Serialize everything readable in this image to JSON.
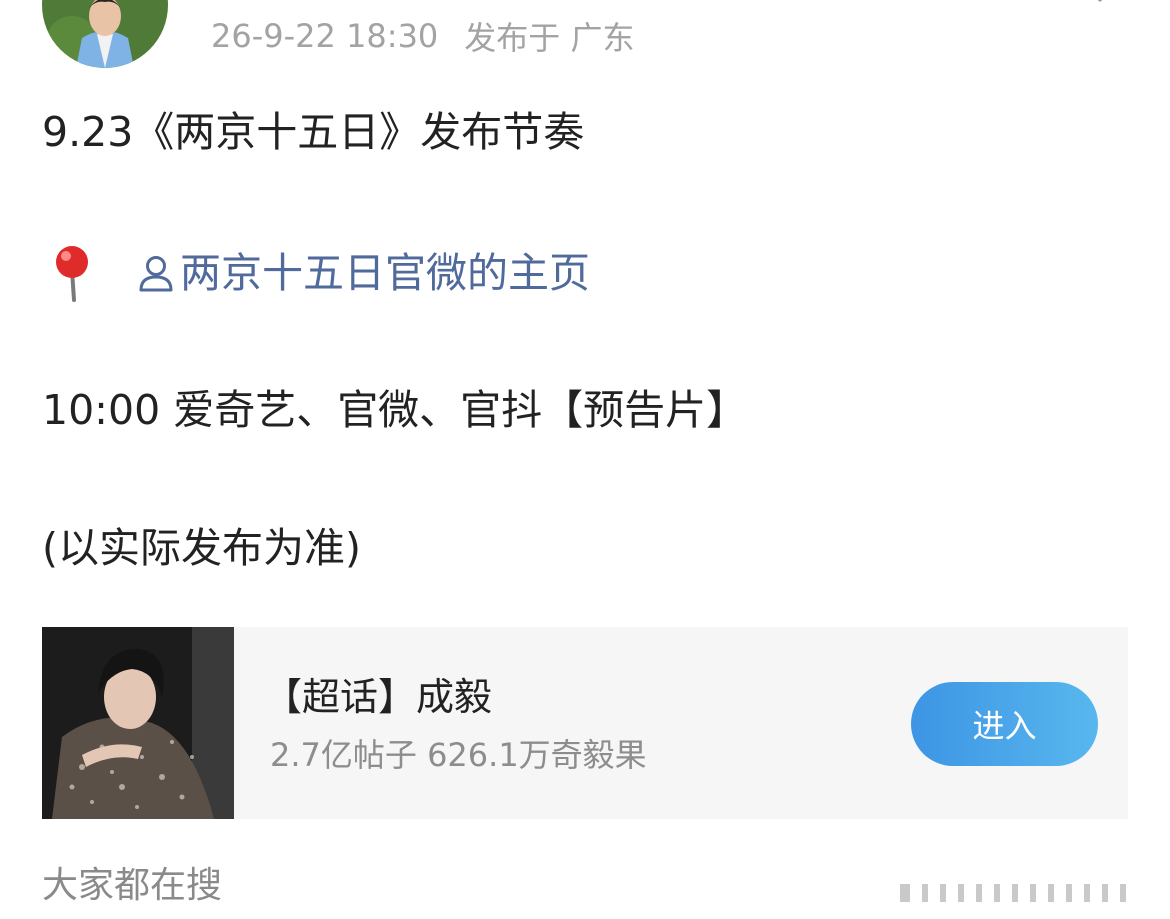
{
  "post": {
    "meta": {
      "time": "26-9-22 18:30",
      "location": "发布于 广东"
    },
    "line1": "9.23《两京十五日》发布节奏",
    "mention": "两京十五日官微的主页",
    "line3": "10:00 爱奇艺、官微、官抖【预告片】",
    "line4": "(以实际发布为准)"
  },
  "icons": {
    "avatar": "avatar",
    "star": "star-outline-icon",
    "pin": "round-pushpin-icon",
    "person": "person-icon"
  },
  "topic_card": {
    "title": "【超话】成毅",
    "stats": "2.7亿帖子 626.1万奇毅果",
    "button_label": "进入"
  },
  "section": {
    "search_heading": "大家都在搜"
  },
  "colors": {
    "mention": "#506a9c",
    "meta": "#a3a3a3",
    "button_start": "#3d95e4",
    "button_end": "#58b7ee",
    "card_bg": "#f6f6f6"
  }
}
